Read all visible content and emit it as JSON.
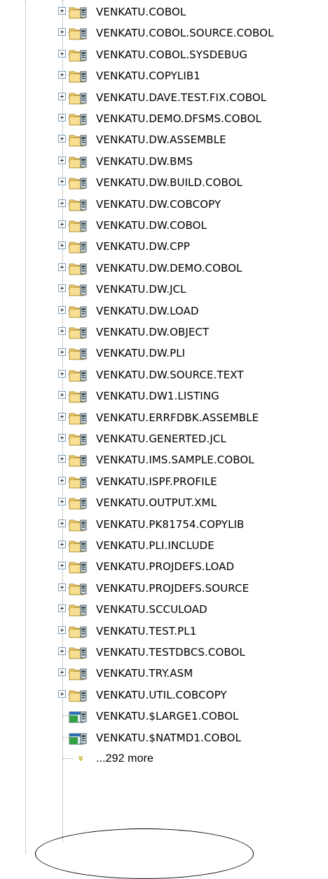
{
  "tree": {
    "folders": [
      "VENKATU.COBOL",
      "VENKATU.COBOL.SOURCE.COBOL",
      "VENKATU.COBOL.SYSDEBUG",
      "VENKATU.COPYLIB1",
      "VENKATU.DAVE.TEST.FIX.COBOL",
      "VENKATU.DEMO.DFSMS.COBOL",
      "VENKATU.DW.ASSEMBLE",
      "VENKATU.DW.BMS",
      "VENKATU.DW.BUILD.COBOL",
      "VENKATU.DW.COBCOPY",
      "VENKATU.DW.COBOL",
      "VENKATU.DW.CPP",
      "VENKATU.DW.DEMO.COBOL",
      "VENKATU.DW.JCL",
      "VENKATU.DW.LOAD",
      "VENKATU.DW.OBJECT",
      "VENKATU.DW.PLI",
      "VENKATU.DW.SOURCE.TEXT",
      "VENKATU.DW1.LISTING",
      "VENKATU.ERRFDBK.ASSEMBLE",
      "VENKATU.GENERTED.JCL",
      "VENKATU.IMS.SAMPLE.COBOL",
      "VENKATU.ISPF.PROFILE",
      "VENKATU.OUTPUT.XML",
      "VENKATU.PK81754.COPYLIB",
      "VENKATU.PLI.INCLUDE",
      "VENKATU.PROJDEFS.LOAD",
      "VENKATU.PROJDEFS.SOURCE",
      "VENKATU.SCCULOAD",
      "VENKATU.TEST.PL1",
      "VENKATU.TESTDBCS.COBOL",
      "VENKATU.TRY.ASM",
      "VENKATU.UTIL.COBCOPY"
    ],
    "files": [
      "VENKATU.$LARGE1.COBOL",
      "VENKATU.$NATMD1.COBOL"
    ],
    "more_label": "...292 more",
    "folder_icon": "dataset-folder-icon",
    "file_icon": "sequential-dataset-icon",
    "more_icon": "expand-more-chevron-icon"
  }
}
